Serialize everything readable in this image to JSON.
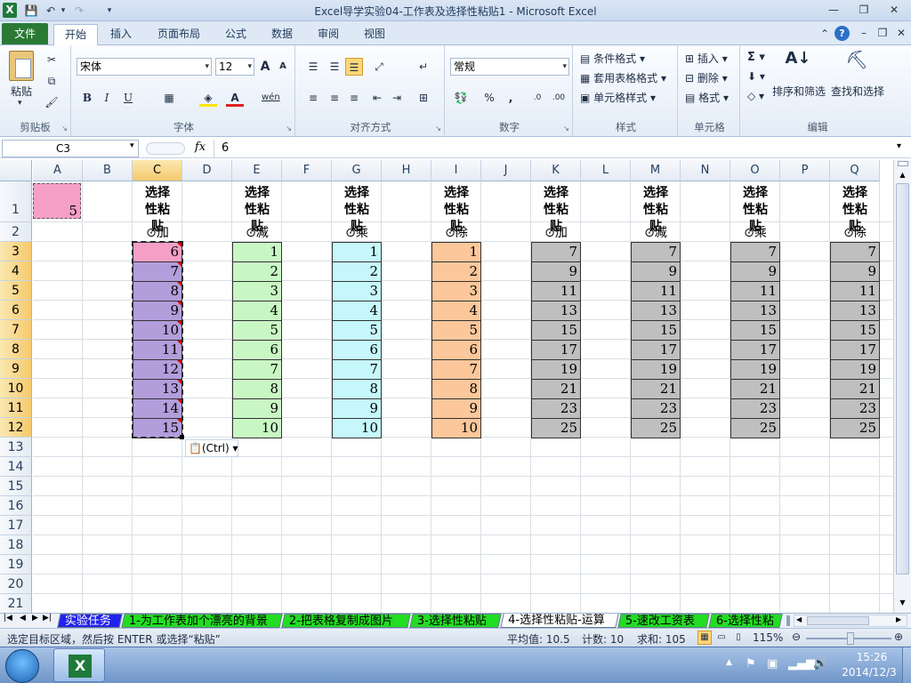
{
  "window": {
    "title": "Excel导学实验04-工作表及选择性粘贴1  -  Microsoft Excel",
    "app_icon": "X",
    "minimize_glyph": "—",
    "restore_glyph": "❐",
    "close_glyph": "✕"
  },
  "ribbon_tabs": [
    "文件",
    "开始",
    "插入",
    "页面布局",
    "公式",
    "数据",
    "审阅",
    "视图"
  ],
  "clipboard_group": {
    "label": "剪贴板",
    "paste": "粘贴"
  },
  "font_group": {
    "label": "字体",
    "font_name": "宋体",
    "font_size": "12",
    "bold": "B",
    "italic": "I",
    "underline": "U",
    "grow": "A",
    "shrink": "A",
    "phonetic": "wén"
  },
  "align_group": {
    "label": "对齐方式"
  },
  "number_group": {
    "label": "数字",
    "format": "常规",
    "percent": "%",
    "comma": ",",
    "inc": ".0",
    "dec": ".00"
  },
  "styles_group": {
    "label": "样式",
    "conditional": "条件格式",
    "table": "套用表格格式",
    "cell_styles": "单元格样式"
  },
  "cells_group": {
    "label": "单元格",
    "insert": "插入",
    "delete": "删除",
    "format": "格式"
  },
  "editing_group": {
    "label": "编辑",
    "sum": "Σ",
    "sort_filter": "排序和筛选",
    "find_select": "查找和选择"
  },
  "formula_bar": {
    "name_box": "C3",
    "fx": "fx",
    "value": "6"
  },
  "columns": [
    "A",
    "B",
    "C",
    "D",
    "E",
    "F",
    "G",
    "H",
    "I",
    "J",
    "K",
    "L",
    "M",
    "N",
    "O",
    "P",
    "Q"
  ],
  "rows": [
    "1",
    "2",
    "3",
    "4",
    "5",
    "6",
    "7",
    "8",
    "9",
    "10",
    "11",
    "12",
    "13",
    "14",
    "15",
    "16",
    "17",
    "18",
    "19",
    "20",
    "21"
  ],
  "a1_value": "5",
  "table_header": "选择性粘贴",
  "ops": [
    "⊙加",
    "⊙减",
    "⊙乘",
    "⊙除",
    "⊙加",
    "⊙减",
    "⊙乘",
    "⊙除"
  ],
  "col_c_values": [
    "6",
    "7",
    "8",
    "9",
    "10",
    "11",
    "12",
    "13",
    "14",
    "15"
  ],
  "seq_values": [
    "1",
    "2",
    "3",
    "4",
    "5",
    "6",
    "7",
    "8",
    "9",
    "10"
  ],
  "odd_values": [
    "7",
    "9",
    "11",
    "13",
    "15",
    "17",
    "19",
    "21",
    "23",
    "25"
  ],
  "paste_options": "(Ctrl)",
  "colors": {
    "a1_fill": "#f59fc6",
    "col_c_fill": "#b39ddb",
    "col_c_first": "#f59fc6",
    "col_e_fill": "#c9f7c4",
    "col_g_fill": "#c6f7fb",
    "col_i_fill": "#fbc79b",
    "gray_fill": "#bfbfbf",
    "file_tab": "#2a7a36",
    "selected_header": "#f5c96c"
  },
  "sheet_tabs": [
    {
      "label": "实验任务",
      "color": "#2222ee",
      "text": "#ffffff"
    },
    {
      "label": "1-为工作表加个漂亮的背景",
      "color": "#22dd22",
      "text": "#000000"
    },
    {
      "label": "2-把表格复制成图片",
      "color": "#22dd22",
      "text": "#000000"
    },
    {
      "label": "3-选择性粘贴",
      "color": "#22dd22",
      "text": "#000000"
    },
    {
      "label": "4-选择性粘贴-运算",
      "color": "#ffffff",
      "text": "#000000"
    },
    {
      "label": "5-速改工资表",
      "color": "#22dd22",
      "text": "#000000"
    },
    {
      "label": "6-选择性粘",
      "color": "#22dd22",
      "text": "#000000"
    }
  ],
  "status": {
    "message": "选定目标区域，然后按 ENTER 或选择“粘贴”",
    "average": "平均值: 10.5",
    "count": "计数: 10",
    "sum": "求和: 105",
    "zoom": "115%"
  },
  "taskbar": {
    "time": "15:26",
    "date": "2014/12/3"
  }
}
